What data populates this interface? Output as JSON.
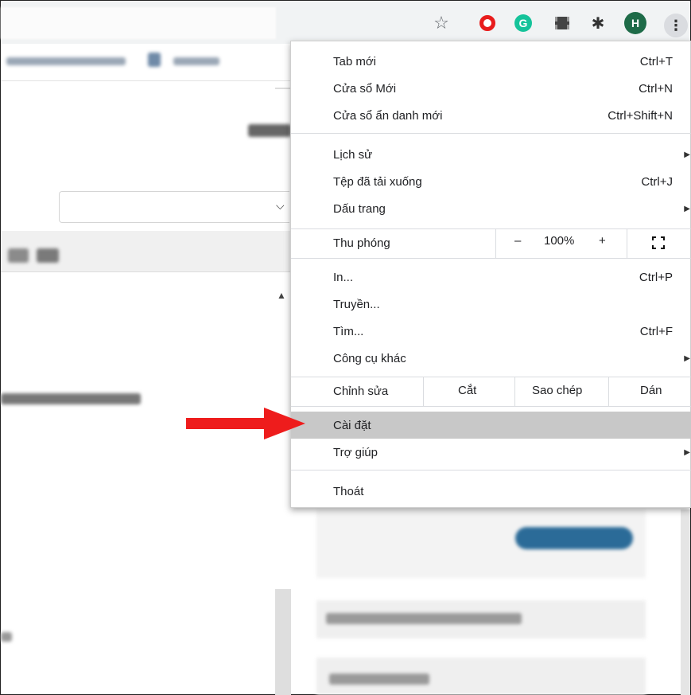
{
  "toolbar": {
    "star_icon": "☆",
    "menu_icon": "⋮",
    "avatar_letter": "H",
    "grammarly_letter": "G",
    "puzzle_icon": "✱"
  },
  "menu": {
    "group1": [
      {
        "label": "Tab mới",
        "shortcut": "Ctrl+T"
      },
      {
        "label": "Cửa sổ Mới",
        "shortcut": "Ctrl+N"
      },
      {
        "label": "Cửa sổ ẩn danh mới",
        "shortcut": "Ctrl+Shift+N"
      }
    ],
    "group2": [
      {
        "label": "Lịch sử",
        "shortcut": ""
      },
      {
        "label": "Tệp đã tải xuống",
        "shortcut": "Ctrl+J"
      },
      {
        "label": "Dấu trang",
        "shortcut": ""
      }
    ],
    "zoom": {
      "label": "Thu phóng",
      "minus": "–",
      "value": "100%",
      "plus": "+"
    },
    "group3": [
      {
        "label": "In...",
        "shortcut": "Ctrl+P"
      },
      {
        "label": "Truyền...",
        "shortcut": ""
      },
      {
        "label": "Tìm...",
        "shortcut": "Ctrl+F"
      },
      {
        "label": "Công cụ khác",
        "shortcut": ""
      }
    ],
    "edit": {
      "label": "Chỉnh sửa",
      "cut": "Cắt",
      "copy": "Sao chép",
      "paste": "Dán"
    },
    "group4": [
      {
        "label": "Cài đặt"
      },
      {
        "label": "Trợ giúp"
      }
    ],
    "exit": {
      "label": "Thoát"
    },
    "submenu_arrow": "▶"
  },
  "colors": {
    "highlight": "#c8c8c8",
    "arrow": "#ee1c1c",
    "avatar": "#1e6b48",
    "grammarly": "#15c39a",
    "opera": "#e81c1c"
  }
}
